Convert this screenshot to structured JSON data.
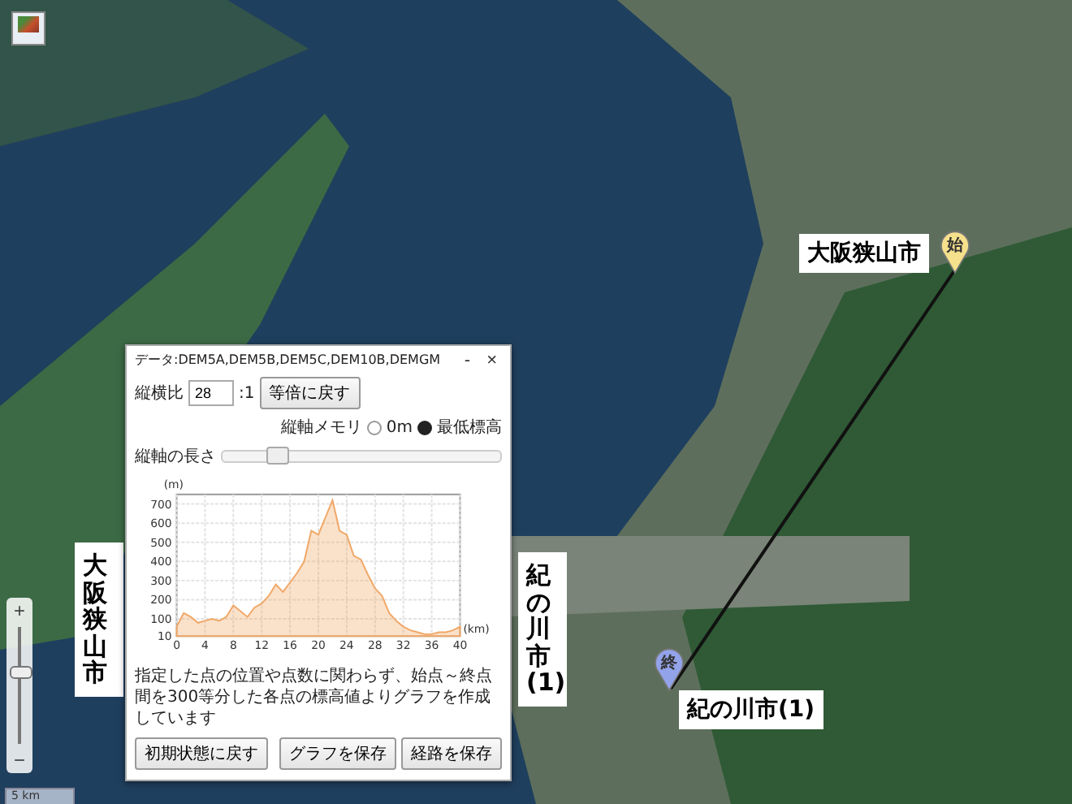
{
  "map": {
    "labels": [
      {
        "kind": "horizontal",
        "text": "大阪狭山市"
      },
      {
        "kind": "vertical",
        "text": "大阪狭山市"
      },
      {
        "kind": "vertical",
        "text": "紀の川市(1)"
      },
      {
        "kind": "horizontal",
        "text": "紀の川市(1)"
      }
    ],
    "markers": [
      {
        "label": "始",
        "color": "#f5e08c"
      },
      {
        "label": "終",
        "color": "#93a3ea"
      }
    ],
    "zoom": {
      "plus": "+",
      "minus": "−",
      "level": 0.6
    },
    "scale": "5 km"
  },
  "dialog": {
    "title": "データ:DEM5A,DEM5B,DEM5C,DEM10B,DEMGM",
    "minimize": "-",
    "close": "×",
    "ratio_label": "縦横比",
    "ratio_value": "28",
    "ratio_suffix": ":1",
    "reset_ratio": "等倍に戻す",
    "axis_memory_label": "縦軸メモリ",
    "radios": [
      {
        "label": "0m",
        "selected": false
      },
      {
        "label": "最低標高",
        "selected": true
      }
    ],
    "axis_length_label": "縦軸の長さ",
    "axis_length": {
      "level": 0.2
    },
    "chart_data": {
      "type": "area",
      "xlabel": "(km)",
      "ylabel": "(m)",
      "x": [
        0,
        1,
        2,
        3,
        4,
        5,
        6,
        7,
        8,
        9,
        10,
        11,
        12,
        13,
        14,
        15,
        16,
        17,
        18,
        19,
        20,
        21,
        22,
        23,
        24,
        25,
        26,
        27,
        28,
        29,
        30,
        31,
        32,
        33,
        34,
        35,
        36,
        37,
        38,
        39,
        40
      ],
      "series": [
        {
          "color": "#f0a868",
          "values": [
            60,
            130,
            110,
            80,
            90,
            100,
            90,
            110,
            170,
            140,
            110,
            160,
            180,
            220,
            280,
            240,
            290,
            340,
            400,
            560,
            540,
            630,
            720,
            560,
            540,
            430,
            410,
            330,
            260,
            220,
            130,
            90,
            60,
            40,
            30,
            20,
            20,
            30,
            30,
            40,
            60
          ]
        }
      ],
      "xlim": [
        0,
        40
      ],
      "ylim": [
        10,
        750
      ],
      "grid": true,
      "xticks": [
        0,
        4,
        8,
        12,
        16,
        20,
        24,
        28,
        32,
        36,
        40
      ],
      "yticks": [
        10,
        100,
        200,
        300,
        400,
        500,
        600,
        700
      ]
    },
    "note": "指定した点の位置や点数に関わらず、始点～終点間を300等分した各点の標高値よりグラフを作成しています",
    "buttons": [
      "初期状態に戻す",
      "グラフを保存",
      "経路を保存"
    ]
  }
}
